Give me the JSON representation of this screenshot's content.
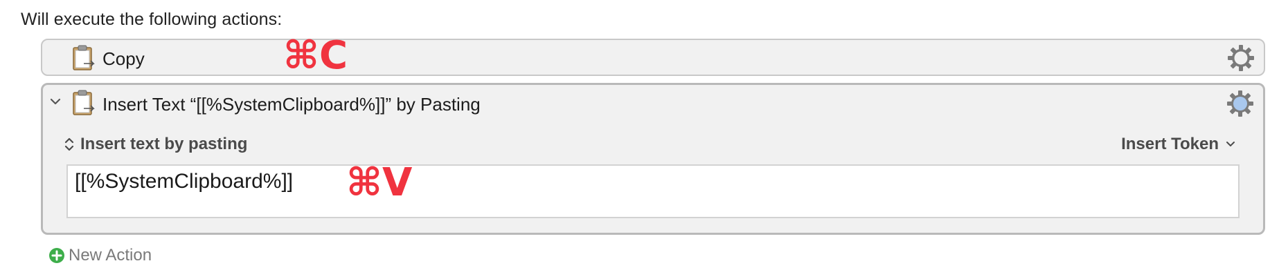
{
  "header": {
    "text": "Will execute the following actions:"
  },
  "actions": [
    {
      "title": "Copy",
      "icon": "clipboard-icon",
      "shortcut_annotation": "⌘C"
    },
    {
      "title": "Insert Text “[[%SystemClipboard%]]” by Pasting",
      "icon": "clipboard-icon",
      "expanded": true,
      "mode_label": "Insert text by pasting",
      "token_menu_label": "Insert Token",
      "text_value": "[[%SystemClipboard%]]",
      "shortcut_annotation": "⌘V"
    }
  ],
  "footer": {
    "new_action_label": "New Action"
  },
  "colors": {
    "annotation_red": "#f0333f",
    "action_background": "#f1f1f1",
    "plus_green": "#3dae4a",
    "gear_active_blue": "#a9c8ee"
  }
}
